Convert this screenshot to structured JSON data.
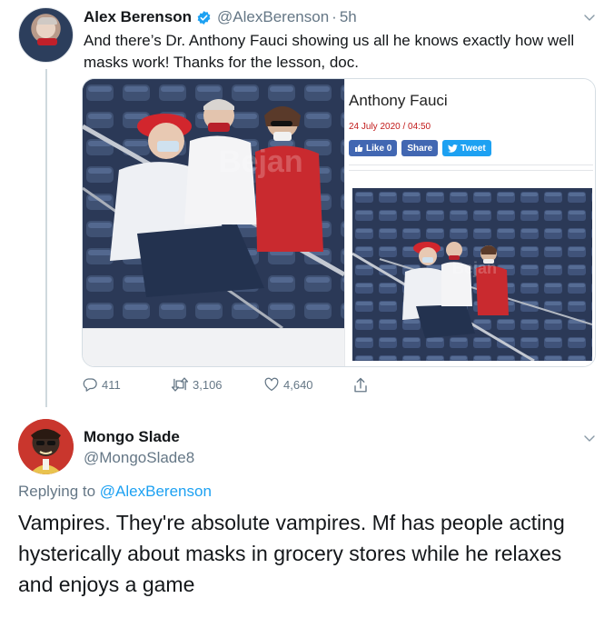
{
  "tweet": {
    "author_name": "Alex Berenson",
    "author_handle": "@AlexBerenson",
    "separator": "·",
    "time": "5h",
    "text": "And there’s Dr. Anthony Fauci showing us all he knows exactly how well masks work! Thanks for the lesson, doc.",
    "media": {
      "watermark": "Bejan",
      "article_title": "Anthony Fauci",
      "article_date": "24 July 2020 / 04:50",
      "like_label": "Like 0",
      "share_label": "Share",
      "tweet_label": "Tweet"
    },
    "actions": {
      "replies": "411",
      "retweets": "3,106",
      "likes": "4,640"
    }
  },
  "reply": {
    "author_name": "Mongo Slade",
    "author_handle": "@MongoSlade8",
    "replying_prefix": "Replying to",
    "replying_to": "@AlexBerenson",
    "text": "Vampires. They're absolute vampires. Mf has people acting hysterically about masks in grocery stores while he relaxes and enjoys a game"
  },
  "colors": {
    "accent": "#1da1f2",
    "secondary_text": "#657786",
    "primary_text": "#14171a",
    "facebook": "#4267b2",
    "date_red": "#c11a1a"
  },
  "icons": [
    "verified-badge-icon",
    "chevron-down-icon",
    "reply-icon",
    "retweet-icon",
    "like-icon",
    "share-icon",
    "facebook-like-icon",
    "twitter-bird-icon"
  ]
}
